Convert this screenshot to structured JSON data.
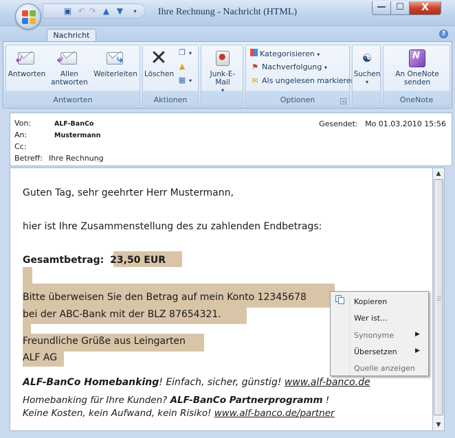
{
  "window": {
    "title": "Ihre Rechnung - Nachricht (HTML)",
    "min_glyph": "—",
    "max_glyph": "☐",
    "close_glyph": "X"
  },
  "ribbon": {
    "tab": "Nachricht",
    "help_glyph": "?",
    "groups": {
      "antworten": {
        "label": "Antworten",
        "reply": "Antworten",
        "reply_all_1": "Allen",
        "reply_all_2": "antworten",
        "forward": "Weiterleiten"
      },
      "aktionen": {
        "label": "Aktionen",
        "delete": "Löschen"
      },
      "junk": {
        "label": "Junk-E-Mail"
      },
      "optionen": {
        "label": "Optionen",
        "categorize": "Kategorisieren",
        "followup": "Nachverfolgung",
        "mark_unread": "Als ungelesen markieren"
      },
      "suchen": {
        "label": "Suchen"
      },
      "onenote": {
        "label": "OneNote",
        "send_1": "An OneNote",
        "send_2": "senden"
      }
    }
  },
  "header": {
    "from_label": "Von:",
    "from_value": "ALF-BanCo",
    "to_label": "An:",
    "to_value": "Mustermann",
    "cc_label": "Cc:",
    "subject_label": "Betreff:",
    "subject_value": "Ihre Rechnung",
    "sent_label": "Gesendet:",
    "sent_value": "Mo 01.03.2010 15:56"
  },
  "message": {
    "greeting": "Guten Tag, sehr geehrter Herr Mustermann,",
    "intro": "hier ist Ihre Zusammenstellung des zu zahlenden Endbetrags:",
    "total_label": "Gesamtbetrag:",
    "total_value": "23,50 EUR",
    "transfer_1": "Bitte überweisen Sie den Betrag auf mein Konto 12345678",
    "transfer_2": "bei der ABC-Bank mit der BLZ 87654321.",
    "regards": "Freundliche Grüße aus Leingarten",
    "company": "ALF AG",
    "promo_brand": "ALF-BanCo Homebanking",
    "promo_text": "! Einfach, sicher, günstig! ",
    "promo_link": "www.alf-banco.de",
    "partner_text": "Homebanking für Ihre Kunden? ",
    "partner_brand": "ALF-BanCo  Partnerprogramm",
    "partner_excl": " !",
    "costs_text": "Keine Kosten, kein Aufwand, kein Risiko! ",
    "partner_link": "www.alf-banco.de/partner"
  },
  "context_menu": {
    "items": [
      {
        "label": "Kopieren",
        "enabled": true,
        "submenu": false
      },
      {
        "label": "Wer ist...",
        "enabled": true,
        "submenu": false
      },
      {
        "label": "Synonyme",
        "enabled": false,
        "submenu": true
      },
      {
        "label": "Übersetzen",
        "enabled": true,
        "submenu": true
      },
      {
        "label": "Quelle anzeigen",
        "enabled": false,
        "submenu": false
      }
    ],
    "submenu_glyph": "▶"
  },
  "colors": {
    "highlight": "#d8c5a8",
    "ribbon_bg": "#dbe7f5",
    "close_red": "#c8462f"
  },
  "icons": [
    "office-button-icon",
    "save-icon",
    "undo-icon",
    "redo-icon",
    "up-arrow-icon",
    "down-arrow-icon",
    "reply-icon",
    "reply-all-icon",
    "forward-icon",
    "delete-icon",
    "move-icon",
    "junk-icon",
    "categorize-icon",
    "flag-icon",
    "mark-unread-icon",
    "binoculars-icon",
    "onenote-icon",
    "copy-icon"
  ]
}
